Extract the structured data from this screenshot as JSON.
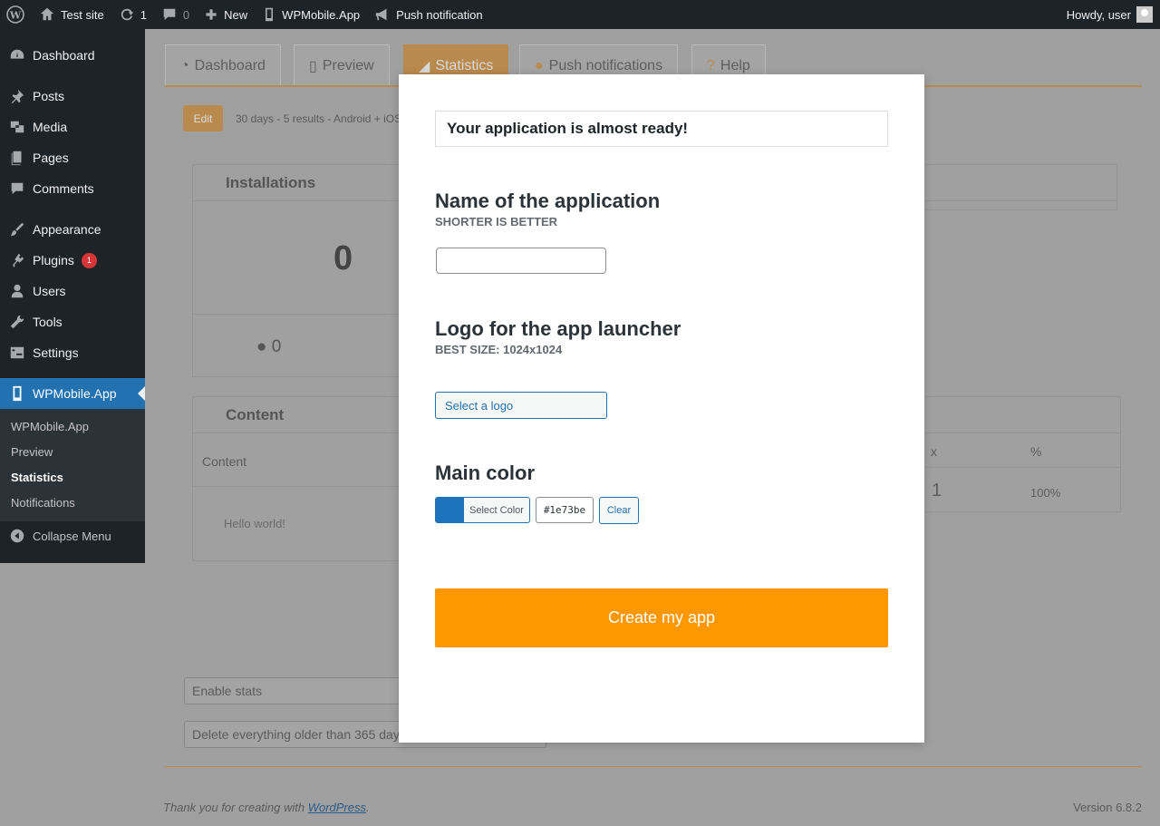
{
  "admin_bar": {
    "site_name": "Test site",
    "updates_count": "1",
    "comments_count": "0",
    "new_label": "New",
    "plugin_label": "WPMobile.App",
    "push_label": "Push notification",
    "greeting": "Howdy, user"
  },
  "sidebar": {
    "items": [
      {
        "label": "Dashboard",
        "icon": "dashboard-icon"
      },
      {
        "label": "Posts",
        "icon": "pin-icon"
      },
      {
        "label": "Media",
        "icon": "media-icon"
      },
      {
        "label": "Pages",
        "icon": "pages-icon"
      },
      {
        "label": "Comments",
        "icon": "comment-icon"
      },
      {
        "label": "Appearance",
        "icon": "brush-icon"
      },
      {
        "label": "Plugins",
        "icon": "plug-icon",
        "badge": "1"
      },
      {
        "label": "Users",
        "icon": "user-icon"
      },
      {
        "label": "Tools",
        "icon": "wrench-icon"
      },
      {
        "label": "Settings",
        "icon": "settings-icon"
      },
      {
        "label": "WPMobile.App",
        "icon": "phone-icon"
      }
    ],
    "submenu": [
      "WPMobile.App",
      "Preview",
      "Statistics",
      "Notifications"
    ],
    "collapse_label": "Collapse Menu"
  },
  "tabs": [
    "Dashboard",
    "Preview",
    "Statistics",
    "Push notifications",
    "Help"
  ],
  "stats": {
    "edit_label": "Edit",
    "filter_text": "30 days - 5 results - Android + iOS",
    "installations_title": "Installations",
    "installations_total": "0",
    "ios_count": "0",
    "content_title": "Content",
    "content_col": "Content",
    "content_row": "Hello world!",
    "right_panel_title_fragment": "s",
    "col_x": "x",
    "col_pct": "%",
    "row_x": "1",
    "row_pct": "100%",
    "enable_stats": "Enable stats",
    "delete_older": "Delete everything older than 365 days"
  },
  "modal": {
    "notice": "Your application is almost ready!",
    "name_title": "Name of the application",
    "name_sub": "SHORTER IS BETTER",
    "name_value": "",
    "logo_title": "Logo for the app launcher",
    "logo_sub": "BEST SIZE: 1024x1024",
    "logo_button": "Select a logo",
    "color_title": "Main color",
    "color_button": "Select Color",
    "color_value": "#1e73be",
    "clear_button": "Clear",
    "create_button": "Create my app"
  },
  "footer": {
    "thanks_prefix": "Thank you for creating with ",
    "thanks_link": "WordPress",
    "thanks_suffix": ".",
    "version": "Version 6.8.2"
  },
  "colors": {
    "accent": "#fe9700",
    "wp_blue": "#2271b1",
    "main_color": "#1e73be"
  }
}
